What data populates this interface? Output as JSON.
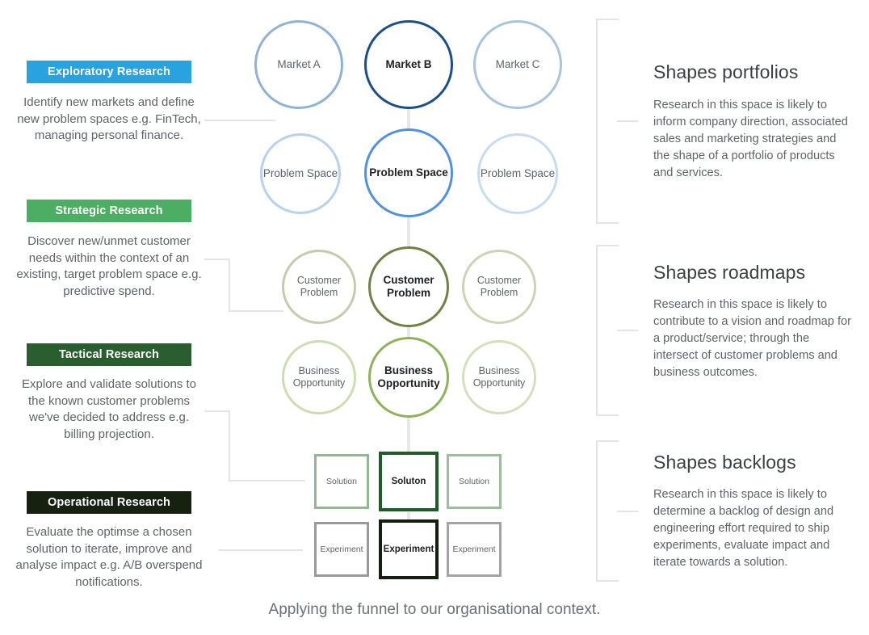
{
  "caption": "Applying the funnel to our organisational context.",
  "left_column": [
    {
      "chip_label": "Exploratory Research",
      "chip_color": "#29a3e0",
      "description": "Identify new markets and define new problem spaces e.g. FinTech, managing personal finance."
    },
    {
      "chip_label": "Strategic Research",
      "chip_color": "#4cae62",
      "description": "Discover new/unmet customer needs within the context of an existing, target problem space e.g. predictive spend."
    },
    {
      "chip_label": "Tactical Research",
      "chip_color": "#2b5e2e",
      "description": "Explore and validate solutions to the known customer problems we've decided to address e.g. billing projection."
    },
    {
      "chip_label": "Operational Research",
      "chip_color": "#16210f",
      "description": "Evaluate the optimse a chosen solution to iterate, improve and analyse impact e.g. A/B overspend notifications."
    }
  ],
  "right_column": [
    {
      "heading": "Shapes portfolios",
      "body": "Research in this space is likely to inform company direction, associated sales and marketing strategies and the shape of a portfolio of products and services."
    },
    {
      "heading": "Shapes roadmaps",
      "body": "Research in this space is likely to contribute to a vision and roadmap for a product/service; through the intersect of customer problems and business outcomes."
    },
    {
      "heading": "Shapes backlogs",
      "body": "Research in this space is likely to determine a backlog of design and engineering effort required to ship experiments, evaluate impact and iterate towards a solution."
    }
  ],
  "funnel_rows": [
    {
      "row_name": "markets",
      "shape": "circle",
      "nodes": [
        {
          "label": "Market A",
          "color": "#8fb2d6",
          "primary": false
        },
        {
          "label": "Market B",
          "color": "#1a4f8a",
          "primary": true
        },
        {
          "label": "Market C",
          "color": "#a8c4de",
          "primary": false
        }
      ]
    },
    {
      "row_name": "problem-spaces",
      "shape": "circle",
      "nodes": [
        {
          "label": "Problem Space",
          "color": "#b6d2f0",
          "primary": false
        },
        {
          "label": "Problem Space",
          "color": "#5191e0",
          "primary": true
        },
        {
          "label": "Problem Space",
          "color": "#c6dcf5",
          "primary": false
        }
      ]
    },
    {
      "row_name": "customer-problems",
      "shape": "circle",
      "nodes": [
        {
          "label": "Customer Problem",
          "color": "#c3ccab",
          "primary": false
        },
        {
          "label": "Customer Problem",
          "color": "#6e8244",
          "primary": true
        },
        {
          "label": "Customer Problem",
          "color": "#ccd4b6",
          "primary": false
        }
      ]
    },
    {
      "row_name": "business-opportunities",
      "shape": "circle",
      "nodes": [
        {
          "label": "Business Opportunity",
          "color": "#cdddb0",
          "primary": false
        },
        {
          "label": "Business Opportunity",
          "color": "#8eb257",
          "primary": true
        },
        {
          "label": "Business Opportunity",
          "color": "#d4e0bc",
          "primary": false
        }
      ]
    },
    {
      "row_name": "solutions",
      "shape": "square",
      "nodes": [
        {
          "label": "Solution",
          "color": "#93b693",
          "primary": false
        },
        {
          "label": "Soluton",
          "color": "#1f5c2a",
          "primary": true
        },
        {
          "label": "Solution",
          "color": "#9dbd9d",
          "primary": false
        }
      ]
    },
    {
      "row_name": "experiments",
      "shape": "square",
      "nodes": [
        {
          "label": "Experiment",
          "color": "#9a9a9a",
          "primary": false
        },
        {
          "label": "Experiment",
          "color": "#13200f",
          "primary": true
        },
        {
          "label": "Experiment",
          "color": "#a3a3a3",
          "primary": false
        }
      ]
    }
  ]
}
